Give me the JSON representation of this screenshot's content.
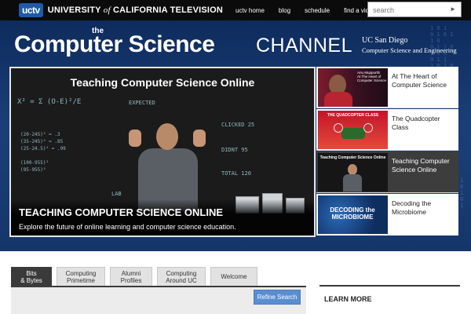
{
  "header": {
    "logo_mark": "uctv",
    "logo_text_1": "UNIVERSITY",
    "logo_text_of": "of",
    "logo_text_2": "CALIFORNIA TELEVISION",
    "nav": [
      "uctv home",
      "blog",
      "schedule",
      "find a video"
    ],
    "search_placeholder": "search"
  },
  "banner": {
    "title_the": "the",
    "title_main": "Computer Science",
    "title_channel": "CHANNEL",
    "ucsd_line1": "UC San Diego",
    "ucsd_line2": "Computer Science and Engineering"
  },
  "feature": {
    "video_title": "Teaching Computer Science Online",
    "heading": "TEACHING COMPUTER SCIENCE ONLINE",
    "subtitle": "Explore the future of online learning and computer science education.",
    "chalk": [
      "X² = Σ (O-E)²/E",
      "EXPECTED",
      "CLICKED 25",
      "DIDNT 95",
      "TOTAL 120",
      "LAB"
    ]
  },
  "side_items": [
    {
      "label": "At The Heart of Computer Science",
      "thumb_caption": "Anu Muppurthi\nAt The Heart of Computer Science",
      "active": false
    },
    {
      "label": "The Quadcopter Class",
      "thumb_caption": "THE QUADCOPTER CLASS",
      "active": false
    },
    {
      "label": "Teaching Computer Science Online",
      "thumb_caption": "Teaching Computer Science Online",
      "active": true
    },
    {
      "label": "Decoding the Microbiome",
      "thumb_caption": "DECODING the MICROBIOME",
      "active": false
    }
  ],
  "tabs": [
    {
      "label": "Bits\n& Bytes",
      "active": true
    },
    {
      "label": "Computing\nPrimetime",
      "active": false
    },
    {
      "label": "Alumni\nProfiles",
      "active": false
    },
    {
      "label": "Computing\nAround UC",
      "active": false
    },
    {
      "label": "Welcome",
      "active": false
    }
  ],
  "refine_label": "Refine Search",
  "learn_more": "LEARN MORE"
}
